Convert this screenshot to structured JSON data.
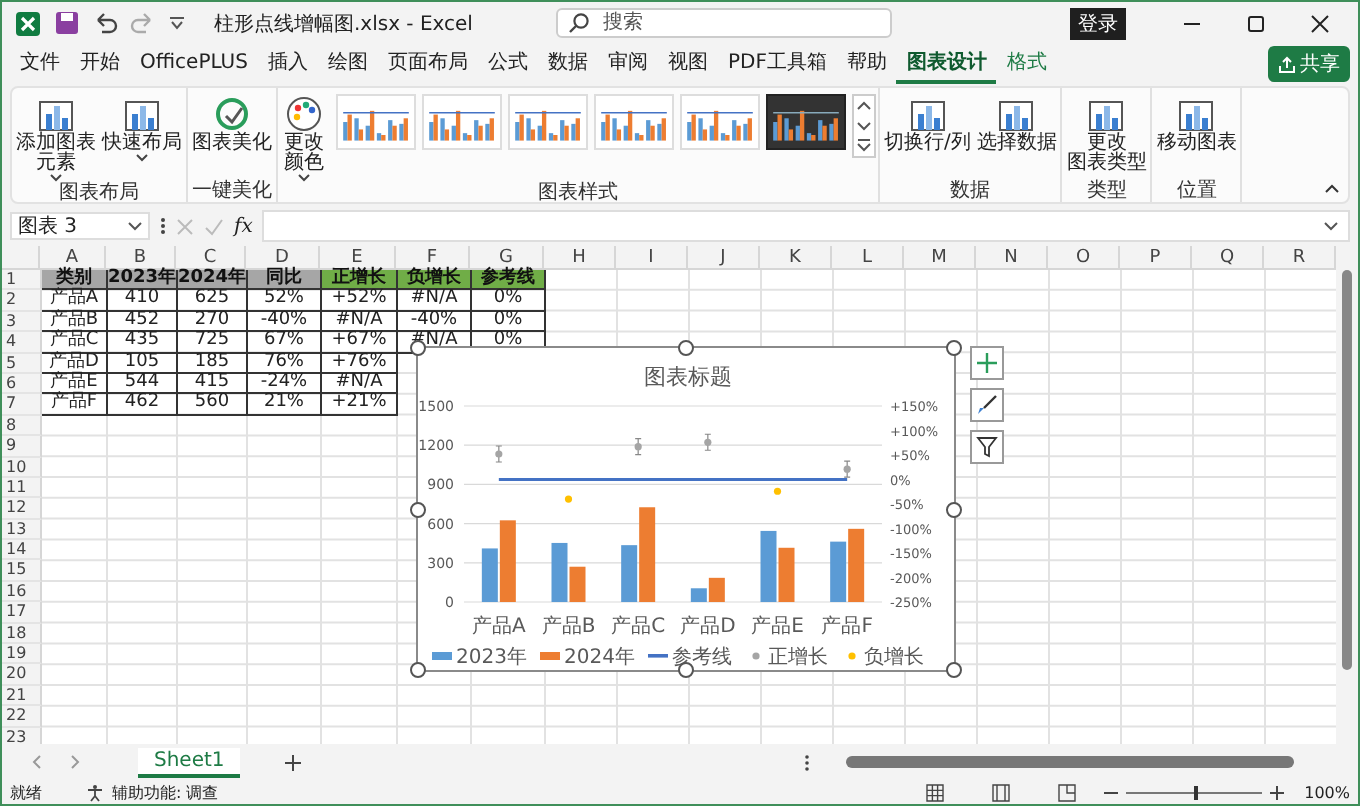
{
  "window": {
    "title": "柱形点线增幅图.xlsx  -  Excel",
    "search_placeholder": "搜索",
    "sign_in": "登录"
  },
  "menu_tabs": [
    {
      "label": "文件",
      "selected": false,
      "contextual": false
    },
    {
      "label": "开始",
      "selected": false,
      "contextual": false
    },
    {
      "label": "OfficePLUS",
      "selected": false,
      "contextual": false
    },
    {
      "label": "插入",
      "selected": false,
      "contextual": false
    },
    {
      "label": "绘图",
      "selected": false,
      "contextual": false
    },
    {
      "label": "页面布局",
      "selected": false,
      "contextual": false
    },
    {
      "label": "公式",
      "selected": false,
      "contextual": false
    },
    {
      "label": "数据",
      "selected": false,
      "contextual": false
    },
    {
      "label": "审阅",
      "selected": false,
      "contextual": false
    },
    {
      "label": "视图",
      "selected": false,
      "contextual": false
    },
    {
      "label": "PDF工具箱",
      "selected": false,
      "contextual": false
    },
    {
      "label": "帮助",
      "selected": false,
      "contextual": false
    },
    {
      "label": "图表设计",
      "selected": true,
      "contextual": true
    },
    {
      "label": "格式",
      "selected": false,
      "contextual": true
    }
  ],
  "share": "共享",
  "ribbon": {
    "groups": [
      {
        "label": "图表布局",
        "buttons": [
          {
            "lines": [
              "添加图表",
              "元素"
            ],
            "has_menu": true
          },
          {
            "lines": [
              "快速布局"
            ],
            "has_menu": true
          }
        ]
      },
      {
        "label": "一键美化",
        "buttons": [
          {
            "lines": [
              "图表美化"
            ],
            "has_menu": false
          }
        ]
      },
      {
        "label": "图表样式",
        "buttons": [
          {
            "lines": [
              "更改",
              "颜色"
            ],
            "has_menu": true
          }
        ],
        "styles": [
          {
            "kind": "light"
          },
          {
            "kind": "light"
          },
          {
            "kind": "light"
          },
          {
            "kind": "light"
          },
          {
            "kind": "light"
          },
          {
            "kind": "dark"
          }
        ]
      },
      {
        "label": "数据",
        "buttons": [
          {
            "lines": [
              "切换行/列"
            ],
            "has_menu": false
          },
          {
            "lines": [
              "选择数据"
            ],
            "has_menu": false
          }
        ]
      },
      {
        "label": "类型",
        "buttons": [
          {
            "lines": [
              "更改",
              "图表类型"
            ],
            "has_menu": false
          }
        ]
      },
      {
        "label": "位置",
        "buttons": [
          {
            "lines": [
              "移动图表"
            ],
            "has_menu": false
          }
        ]
      }
    ]
  },
  "formula_bar": {
    "name_box": "图表 3",
    "fx": "fx"
  },
  "columns": [
    "A",
    "B",
    "C",
    "D",
    "E",
    "F",
    "G",
    "H",
    "I",
    "J",
    "K",
    "L",
    "M",
    "N",
    "O",
    "P",
    "Q",
    "R"
  ],
  "row_numbers": [
    "1",
    "2",
    "3",
    "4",
    "5",
    "6",
    "7",
    "8",
    "9",
    "10",
    "11",
    "12",
    "13",
    "14",
    "15",
    "16",
    "17",
    "18",
    "19",
    "20",
    "21",
    "22",
    "23"
  ],
  "table": {
    "header": [
      {
        "text": "类别",
        "color": "#a6a6a6"
      },
      {
        "text": "2023年",
        "color": "#a6a6a6"
      },
      {
        "text": "2024年",
        "color": "#a6a6a6"
      },
      {
        "text": "同比",
        "color": "#a6a6a6"
      },
      {
        "text": "正增长",
        "color": "#70ad47"
      },
      {
        "text": "负增长",
        "color": "#70ad47"
      },
      {
        "text": "参考线",
        "color": "#70ad47"
      }
    ],
    "rows": [
      [
        "产品A",
        "410",
        "625",
        "52%",
        "+52%",
        "#N/A",
        "0%"
      ],
      [
        "产品B",
        "452",
        "270",
        "-40%",
        "#N/A",
        "-40%",
        "0%"
      ],
      [
        "产品C",
        "435",
        "725",
        "67%",
        "+67%",
        "#N/A",
        "0%"
      ],
      [
        "产品D",
        "105",
        "185",
        "76%",
        "+76%"
      ],
      [
        "产品E",
        "544",
        "415",
        "-24%",
        "#N/A"
      ],
      [
        "产品F",
        "462",
        "560",
        "21%",
        "+21%"
      ]
    ]
  },
  "chart": {
    "chart_data": {
      "type": "bar",
      "title": "图表标题",
      "categories": [
        "产品A",
        "产品B",
        "产品C",
        "产品D",
        "产品E",
        "产品F"
      ],
      "series": [
        {
          "name": "2023年",
          "color": "#5b9bd5",
          "type": "bar",
          "values": [
            410,
            452,
            435,
            105,
            544,
            462
          ]
        },
        {
          "name": "2024年",
          "color": "#ed7d31",
          "type": "bar",
          "values": [
            625,
            270,
            725,
            185,
            415,
            560
          ]
        },
        {
          "name": "参考线",
          "color": "#4472c4",
          "type": "line",
          "axis": "y2",
          "values": [
            0,
            0,
            0,
            0,
            0,
            0
          ]
        },
        {
          "name": "正增长",
          "color": "#a5a5a5",
          "type": "scatter",
          "axis": "y2",
          "values": [
            52,
            null,
            67,
            76,
            null,
            21
          ]
        },
        {
          "name": "负增长",
          "color": "#ffc000",
          "type": "scatter",
          "axis": "y2",
          "values": [
            null,
            -40,
            null,
            null,
            -24,
            null
          ]
        }
      ],
      "stacked": false,
      "grid": true,
      "legend": true,
      "ylim": [
        0,
        1500
      ],
      "yticks": [
        0,
        300,
        600,
        900,
        1200,
        1500
      ],
      "y2lim": [
        -250,
        150
      ],
      "y2ticks": [
        {
          "value": 150,
          "label": "+150%"
        },
        {
          "value": 100,
          "label": "+100%"
        },
        {
          "value": 50,
          "label": "+50%"
        },
        {
          "value": 0,
          "label": "0%"
        },
        {
          "value": -50,
          "label": "-50%"
        },
        {
          "value": -100,
          "label": "-100%"
        },
        {
          "value": -150,
          "label": "-150%"
        },
        {
          "value": -200,
          "label": "-200%"
        },
        {
          "value": -250,
          "label": "-250%"
        }
      ]
    }
  },
  "sheet_tabs": [
    {
      "label": "Sheet1",
      "selected": true
    }
  ],
  "status_bar": {
    "ready": "就绪",
    "accessibility": "辅助功能: 调查",
    "zoom": "100%",
    "zoom_level": {
      "level": 0.5
    }
  }
}
